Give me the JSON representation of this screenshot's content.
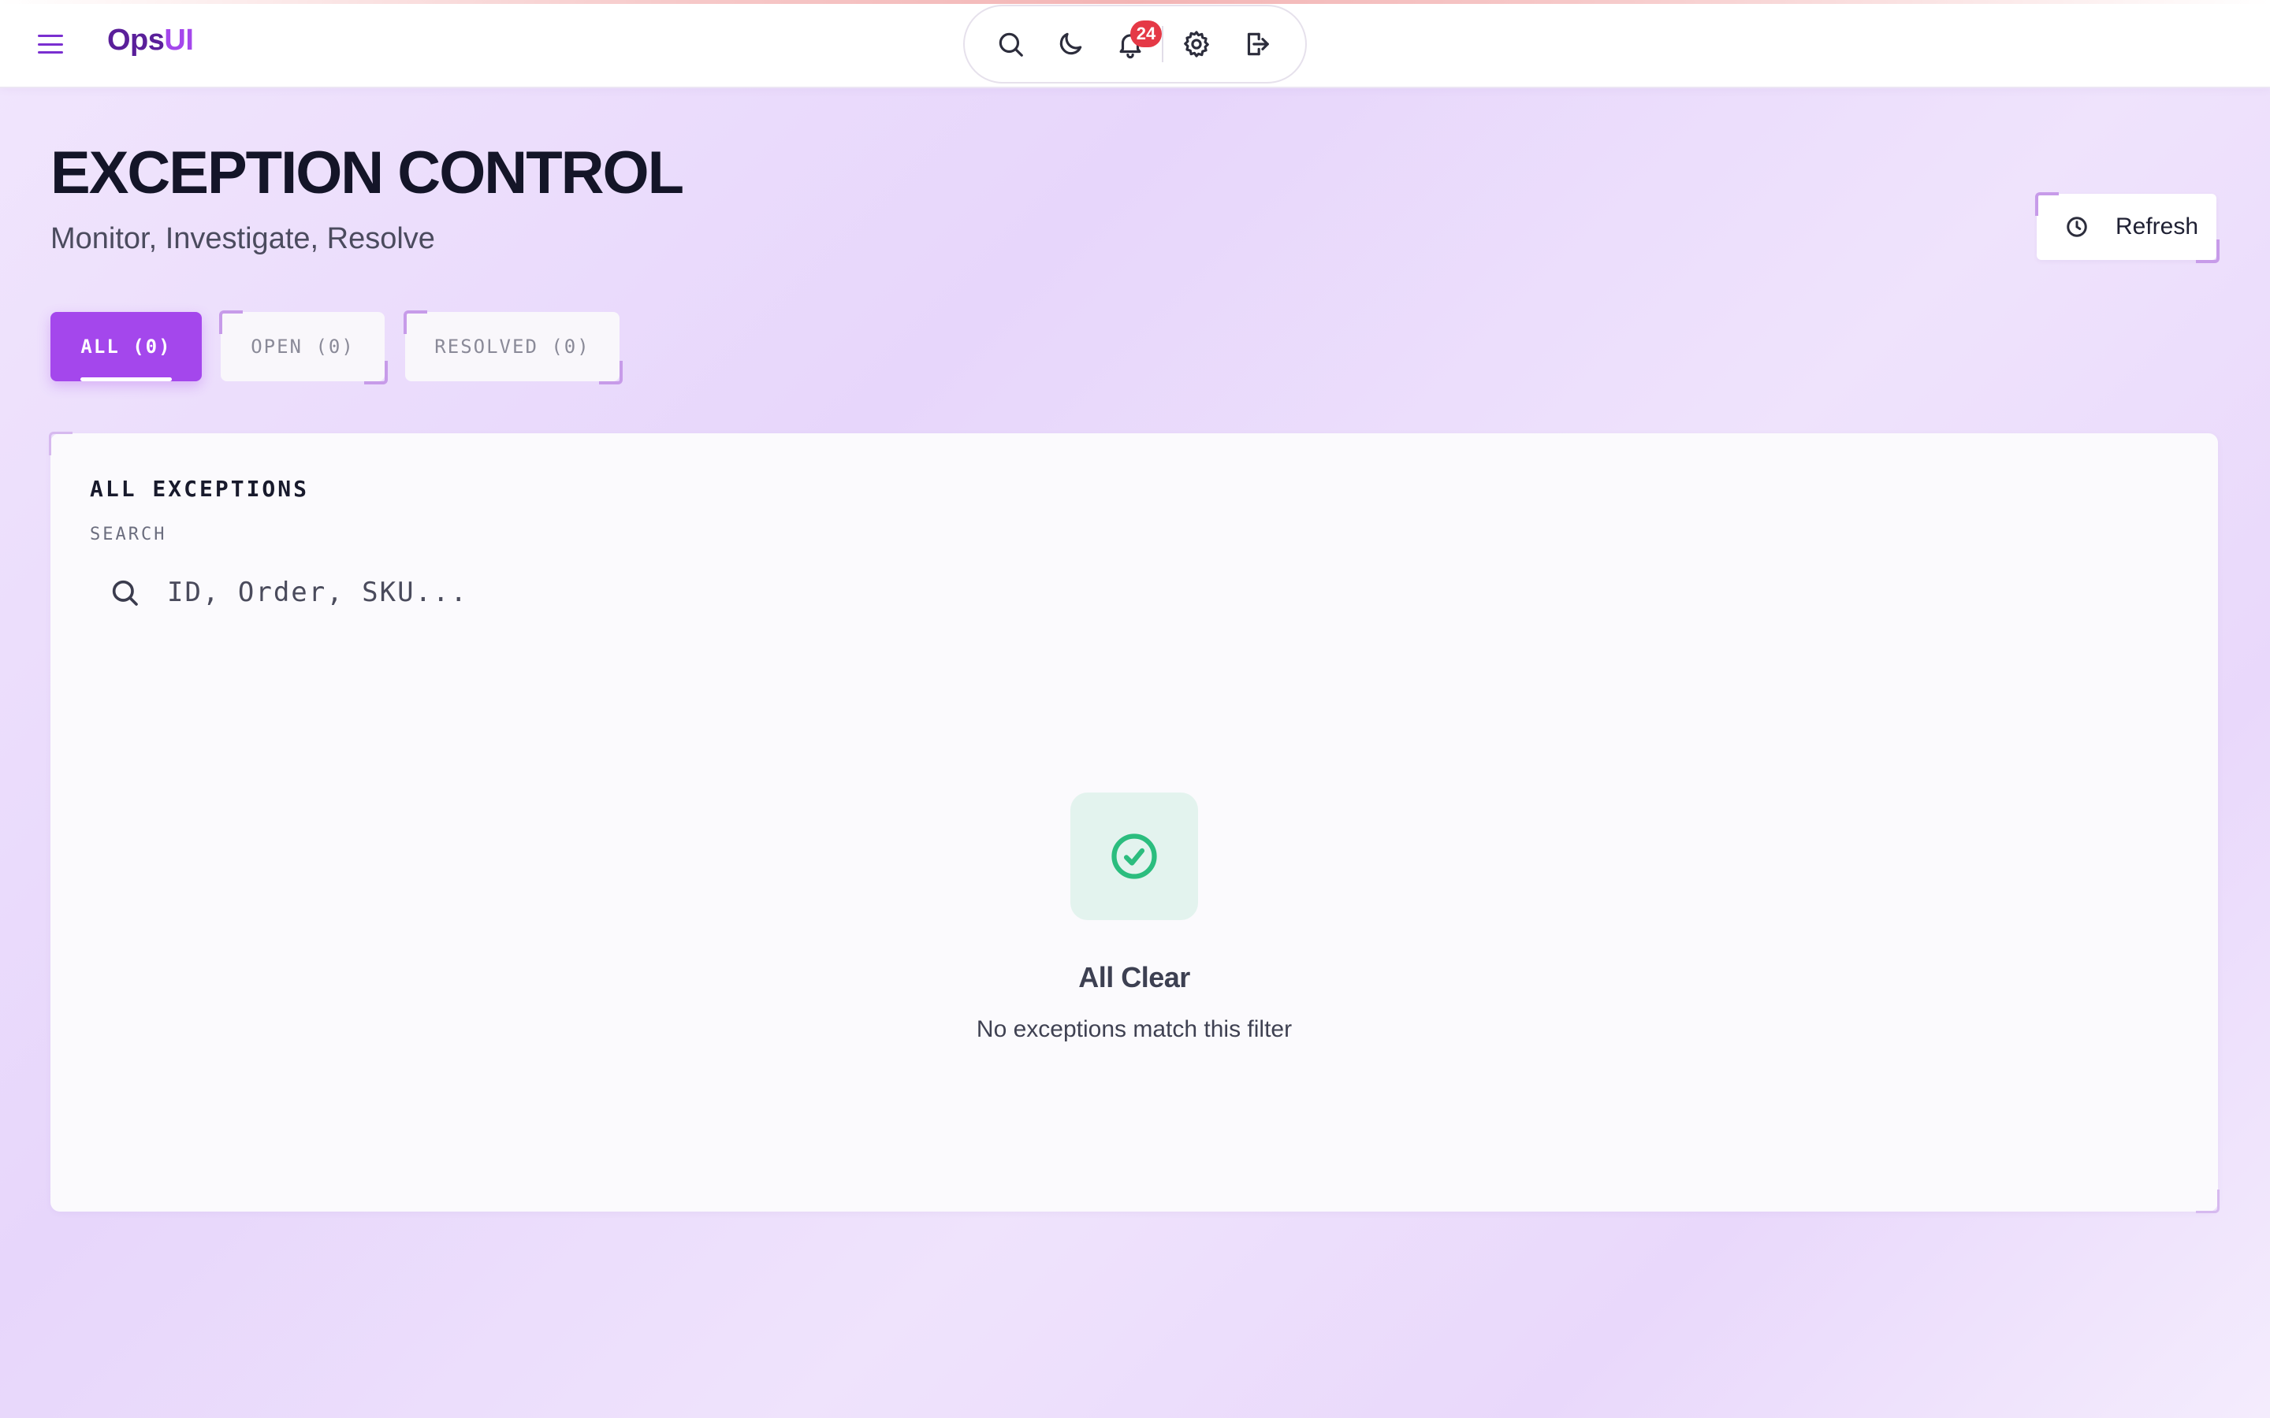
{
  "app": {
    "brand_part1": "Ops",
    "brand_part2": "UI"
  },
  "toolbar": {
    "icons": [
      "search-icon",
      "moon-icon",
      "bell-icon",
      "gear-icon",
      "logout-icon"
    ],
    "notification_count": "24"
  },
  "header": {
    "title": "EXCEPTION CONTROL",
    "subtitle": "Monitor, Investigate, Resolve",
    "refresh_label": "Refresh"
  },
  "tabs": [
    {
      "label": "ALL (0)",
      "active": true
    },
    {
      "label": "OPEN (0)",
      "active": false
    },
    {
      "label": "RESOLVED (0)",
      "active": false
    }
  ],
  "panel": {
    "title": "ALL EXCEPTIONS",
    "search_label": "SEARCH",
    "search_placeholder": "ID, Order, SKU...",
    "search_value": "",
    "empty_title": "All Clear",
    "empty_message": "No exceptions match this filter"
  },
  "colors": {
    "accent": "#a447ec",
    "brand_dark": "#5a1f9a",
    "badge": "#e53946",
    "success": "#2bbd7e"
  }
}
